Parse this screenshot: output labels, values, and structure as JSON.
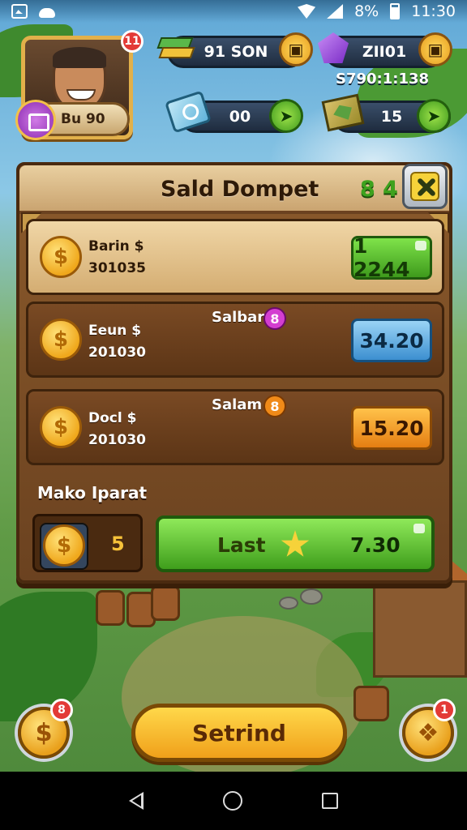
{
  "status_bar": {
    "battery_text": "8%",
    "time": "11:30"
  },
  "hud": {
    "avatar_badge": "11",
    "level_label": "Bu 90",
    "resource1_value": "91 SON",
    "resource2_value": "ZII01",
    "resource2_sub": "S790:1:138",
    "resource3_value": "00",
    "resource4_value": "15"
  },
  "panel": {
    "title": "Sald Dompet",
    "counter": "8 4",
    "rows": [
      {
        "name": "Barin $",
        "amount": "301035",
        "button_value": "1 2244"
      },
      {
        "name": "Eeun $",
        "amount": "201030",
        "tag_label": "Salbar",
        "tag_badge": "8",
        "button_value": "34.20"
      },
      {
        "name": "Docl $",
        "amount": "201030",
        "tag_label": "Salam",
        "tag_badge": "8",
        "button_value": "15.20"
      }
    ],
    "section_label": "Mako Iparat",
    "count_value": "5",
    "action_label": "Last",
    "action_amount": "7.30"
  },
  "bottom": {
    "left_badge": "8",
    "primary_label": "Setrind",
    "right_badge": "1"
  },
  "colors": {
    "wood": "#8b5a2b",
    "gold": "#f0a81c",
    "green_button": "#3e9a1c",
    "blue_button": "#3c8fd0",
    "orange_button": "#e57e12",
    "badge_red": "#e33a36"
  },
  "icons": {
    "resource1": "books-icon",
    "resource2": "gem-icon",
    "resource3": "card-icon",
    "resource4": "map-icon",
    "coin": "coin-icon"
  }
}
